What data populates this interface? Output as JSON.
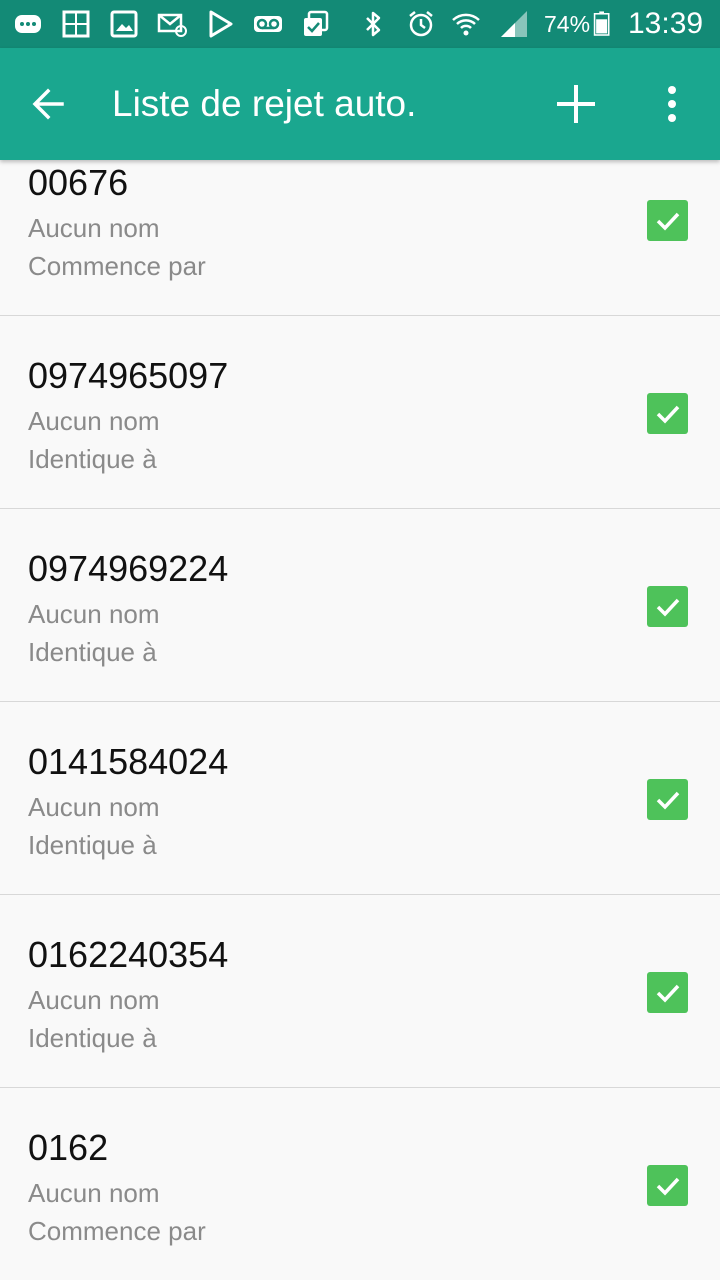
{
  "status_bar": {
    "icons": [
      "messages-icon",
      "gallery-icon",
      "image-icon",
      "email-icon",
      "play-store-icon",
      "voicemail-icon",
      "tasks-icon",
      "bluetooth-icon",
      "alarm-icon",
      "wifi-icon",
      "signal-icon"
    ],
    "battery_percent": "74%",
    "time": "13:39"
  },
  "app_bar": {
    "title": "Liste de rejet auto.",
    "back_icon": "back-arrow-icon",
    "add_icon": "add-icon",
    "more_icon": "more-vert-icon",
    "color": "#1aa78f"
  },
  "list": {
    "items": [
      {
        "number": "00676",
        "name": "Aucun nom",
        "match": "Commence par",
        "checked": true
      },
      {
        "number": "0974965097",
        "name": "Aucun nom",
        "match": "Identique à",
        "checked": true
      },
      {
        "number": "0974969224",
        "name": "Aucun nom",
        "match": "Identique à",
        "checked": true
      },
      {
        "number": "0141584024",
        "name": "Aucun nom",
        "match": "Identique à",
        "checked": true
      },
      {
        "number": "0162240354",
        "name": "Aucun nom",
        "match": "Identique à",
        "checked": true
      },
      {
        "number": "0162",
        "name": "Aucun nom",
        "match": "Commence par",
        "checked": true
      }
    ],
    "checkbox_color": "#4ec25a"
  }
}
